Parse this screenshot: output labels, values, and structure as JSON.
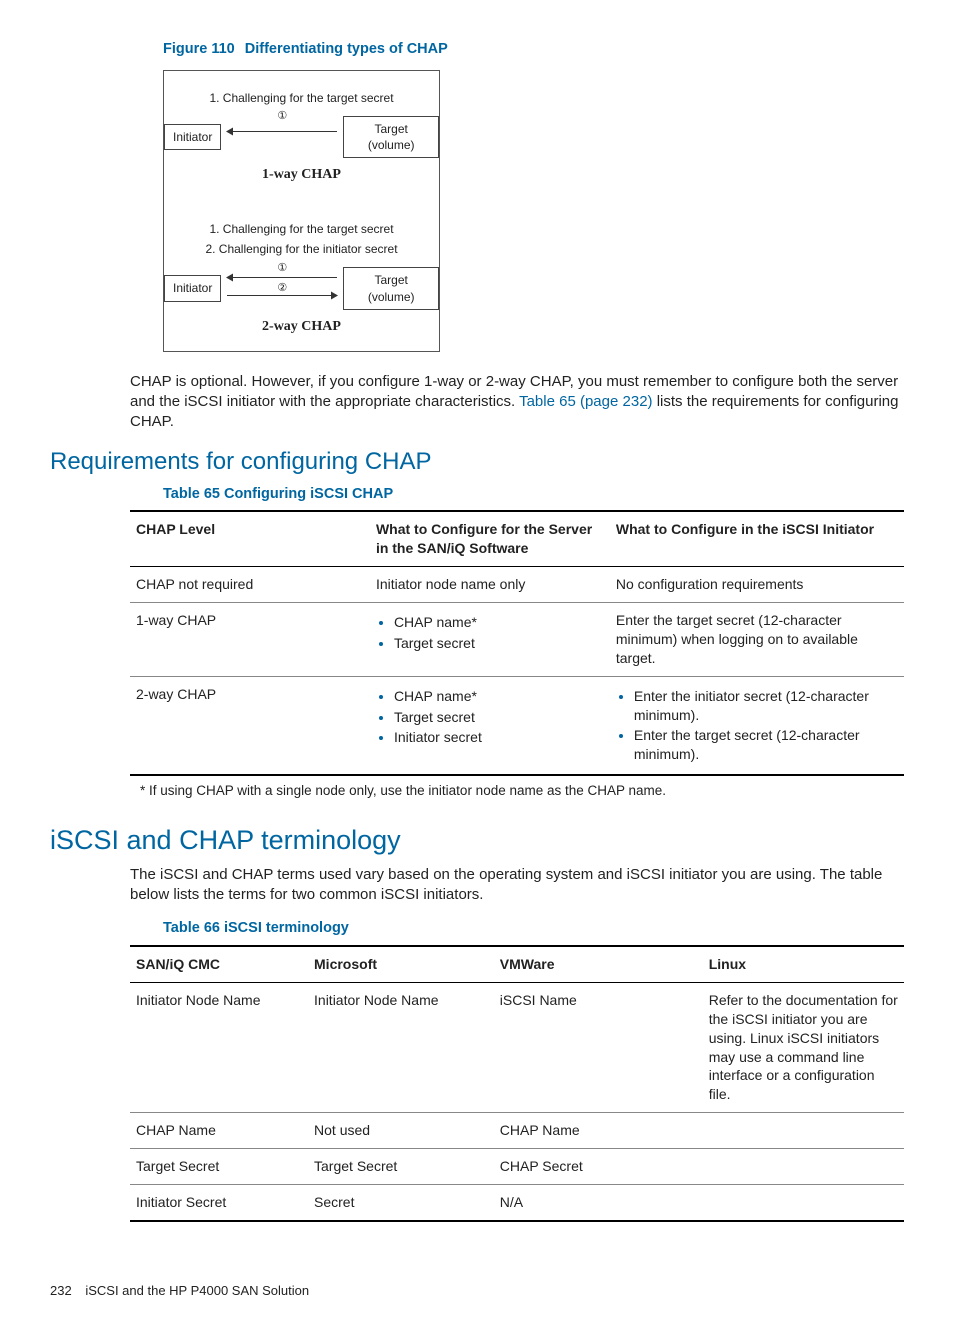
{
  "figure": {
    "label": "Figure 110",
    "title": "Differentiating types of CHAP",
    "oneway": {
      "step1": "1. Challenging for the target secret",
      "initiator": "Initiator",
      "target": "Target (volume)",
      "marker1": "①",
      "caption": "1-way CHAP"
    },
    "twoway": {
      "step1": "1. Challenging for the target secret",
      "step2": "2. Challenging for the initiator secret",
      "initiator": "Initiator",
      "target": "Target (volume)",
      "marker1": "①",
      "marker2": "②",
      "caption": "2-way CHAP"
    }
  },
  "para1_a": "CHAP is optional. However, if you configure 1-way or 2-way CHAP, you must remember to configure both the server and the iSCSI initiator with the appropriate characteristics. ",
  "para1_link": "Table 65 (page 232)",
  "para1_b": " lists the requirements for configuring CHAP.",
  "section1": "Requirements for configuring CHAP",
  "table65": {
    "title": "Table 65 Configuring iSCSI CHAP",
    "head": {
      "c1": "CHAP Level",
      "c2": "What to Configure for the Server in the SAN/iQ Software",
      "c3": "What to Configure in the iSCSI Initiator"
    },
    "rows": [
      {
        "c1": "CHAP not required",
        "c2_text": "Initiator node name only",
        "c3_text": "No configuration requirements"
      },
      {
        "c1": "1-way CHAP",
        "c2_items": [
          "CHAP name*",
          "Target secret"
        ],
        "c3_text": "Enter the target secret (12-character minimum) when logging on to available target."
      },
      {
        "c1": "2-way CHAP",
        "c2_items": [
          "CHAP name*",
          "Target secret",
          "Initiator secret"
        ],
        "c3_items": [
          "Enter the initiator secret (12-character minimum).",
          "Enter the target secret (12-character minimum)."
        ]
      }
    ],
    "footnote": "* If using CHAP with a single node only, use the initiator node name as the CHAP name."
  },
  "section2": "iSCSI and CHAP terminology",
  "para2": "The iSCSI and CHAP terms used vary based on the operating system and iSCSI initiator you are using. The table below lists the terms for two common iSCSI initiators.",
  "table66": {
    "title": "Table 66 iSCSI terminology",
    "head": {
      "c1": "SAN/iQ CMC",
      "c2": "Microsoft",
      "c3": "VMWare",
      "c4": "Linux"
    },
    "rows": [
      {
        "c1": "Initiator Node Name",
        "c2": "Initiator Node Name",
        "c3": "iSCSI Name",
        "c4": "Refer to the documentation for the iSCSI initiator you are using. Linux iSCSI initiators may use a command line interface or a configuration file."
      },
      {
        "c1": "CHAP Name",
        "c2": "Not used",
        "c3": "CHAP Name",
        "c4": ""
      },
      {
        "c1": "Target Secret",
        "c2": "Target Secret",
        "c3": "CHAP Secret",
        "c4": ""
      },
      {
        "c1": "Initiator Secret",
        "c2": "Secret",
        "c3": "N/A",
        "c4": ""
      }
    ]
  },
  "footer": {
    "page": "232",
    "chapter": "iSCSI and the HP P4000 SAN Solution"
  }
}
